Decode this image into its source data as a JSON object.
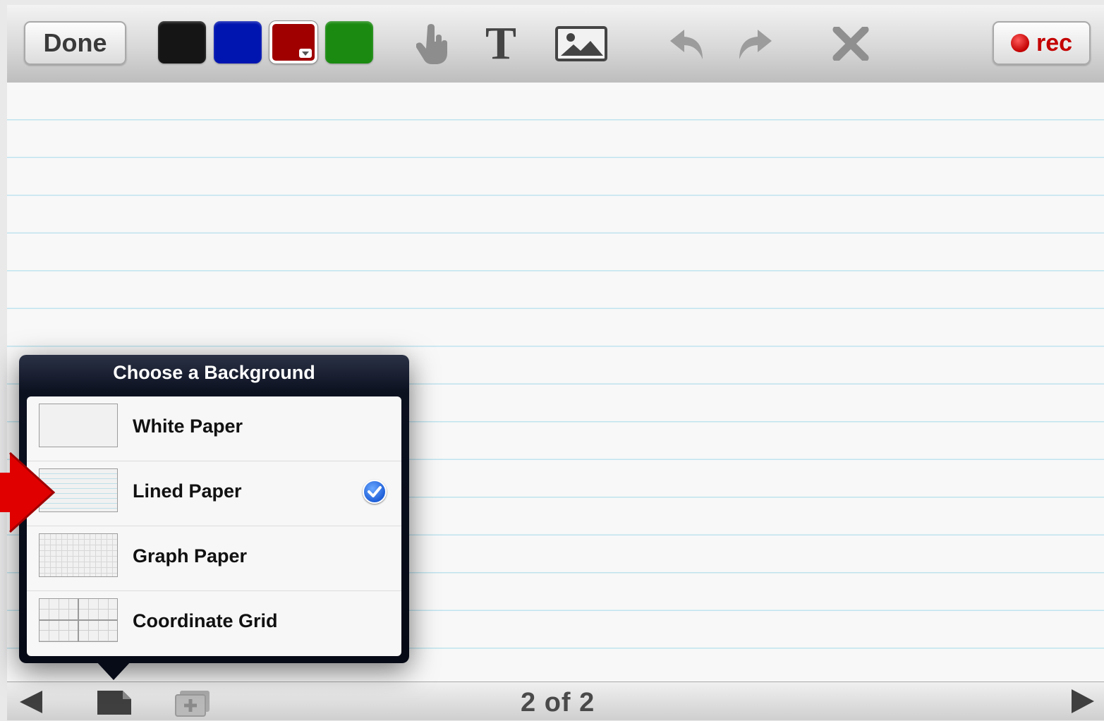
{
  "toolbar": {
    "done_label": "Done",
    "rec_label": "rec",
    "colors": [
      {
        "name": "black",
        "hex": "#151515",
        "selected": false
      },
      {
        "name": "blue",
        "hex": "#0014b0",
        "selected": false
      },
      {
        "name": "red",
        "hex": "#a00000",
        "selected": true
      },
      {
        "name": "green",
        "hex": "#1a8a10",
        "selected": false
      }
    ],
    "tools": [
      "hand-icon",
      "text-tool-icon",
      "image-icon",
      "undo-icon",
      "redo-icon",
      "clear-icon"
    ],
    "text_tool_glyph": "T"
  },
  "popover": {
    "title": "Choose a Background",
    "items": [
      {
        "label": "White Paper",
        "thumb": "white",
        "selected": false
      },
      {
        "label": "Lined Paper",
        "thumb": "lined",
        "selected": true
      },
      {
        "label": "Graph Paper",
        "thumb": "graph",
        "selected": false
      },
      {
        "label": "Coordinate Grid",
        "thumb": "coord",
        "selected": false
      }
    ]
  },
  "canvas": {
    "background": "lined",
    "line_color": "#bfe3ee"
  },
  "bottombar": {
    "page_indicator": "2 of 2"
  }
}
